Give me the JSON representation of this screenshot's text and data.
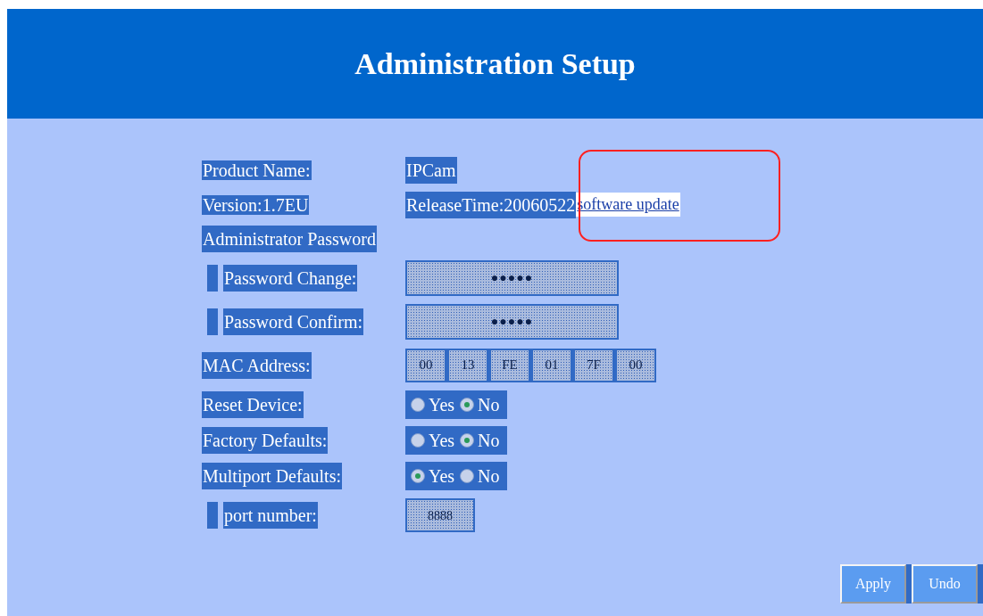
{
  "header": {
    "title": "Administration Setup"
  },
  "info": [
    {
      "label": "Product Name:",
      "value": "IPCam"
    },
    {
      "label": "Version:1.7EU",
      "value": "ReleaseTime:20060522",
      "link": "software update"
    }
  ],
  "section": "Administrator Password",
  "rows": [
    {
      "kind": "password",
      "label": "Password Change:",
      "marker": true,
      "value": "●●●●●"
    },
    {
      "kind": "password",
      "label": "Password Confirm:",
      "marker": true,
      "value": "●●●●●"
    },
    {
      "kind": "mac",
      "label": "MAC Address:",
      "marker": false,
      "parts": [
        "00",
        "13",
        "FE",
        "01",
        "7F",
        "00"
      ]
    },
    {
      "kind": "radio",
      "label": "Reset Device:",
      "marker": false,
      "options": [
        {
          "label": "Yes",
          "selected": false
        },
        {
          "label": "No",
          "selected": true
        }
      ]
    },
    {
      "kind": "radio",
      "label": "Factory Defaults:",
      "marker": false,
      "options": [
        {
          "label": "Yes",
          "selected": false
        },
        {
          "label": "No",
          "selected": true
        }
      ]
    },
    {
      "kind": "radio",
      "label": "Multiport Defaults:",
      "marker": false,
      "options": [
        {
          "label": "Yes",
          "selected": true
        },
        {
          "label": "No",
          "selected": false
        }
      ]
    },
    {
      "kind": "port",
      "label": "port number:",
      "marker": true,
      "value": "8888"
    }
  ],
  "buttons": [
    "Apply",
    "Undo"
  ]
}
